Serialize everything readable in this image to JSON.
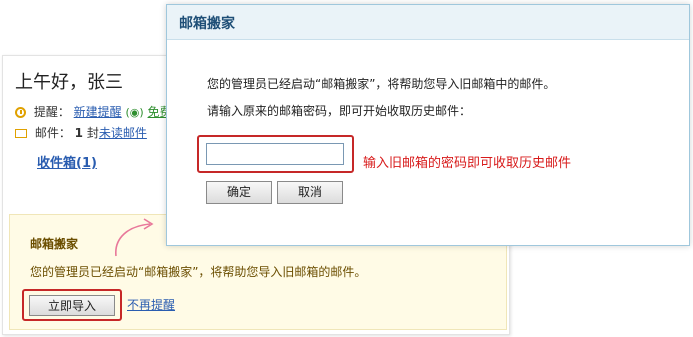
{
  "home": {
    "greeting": "上午好，张三",
    "reminder_label": "提醒：",
    "reminder_new_link": "新建提醒",
    "reminder_free_link": "免费",
    "mail_label": "邮件：",
    "mail_count": "1",
    "mail_count_suffix": "封",
    "unread_link": "未读邮件",
    "inbox_link": "收件箱(1)"
  },
  "banner": {
    "title": "邮箱搬家",
    "text": "您的管理员已经启动“邮箱搬家”，将帮助您导入旧邮箱的邮件。",
    "import_button": "立即导入",
    "no_remind_link": "不再提醒"
  },
  "dialog": {
    "title": "邮箱搬家",
    "line1": "您的管理员已经启动“邮箱搬家”，将帮助您导入旧邮箱中的邮件。",
    "line2": "请输入原来的邮箱密码，即可开始收取历史邮件：",
    "password_value": "",
    "hint": "输入旧邮箱的密码即可收取历史邮件",
    "ok_button": "确定",
    "cancel_button": "取消"
  },
  "colors": {
    "highlight": "#c62828",
    "hint_text": "#d81b1b",
    "link": "#2a5db0",
    "dialog_header": "#eaf3f8",
    "banner_bg": "#fffbe6"
  },
  "icons": [
    "clock-icon",
    "envelope-icon",
    "arrow-icon"
  ]
}
